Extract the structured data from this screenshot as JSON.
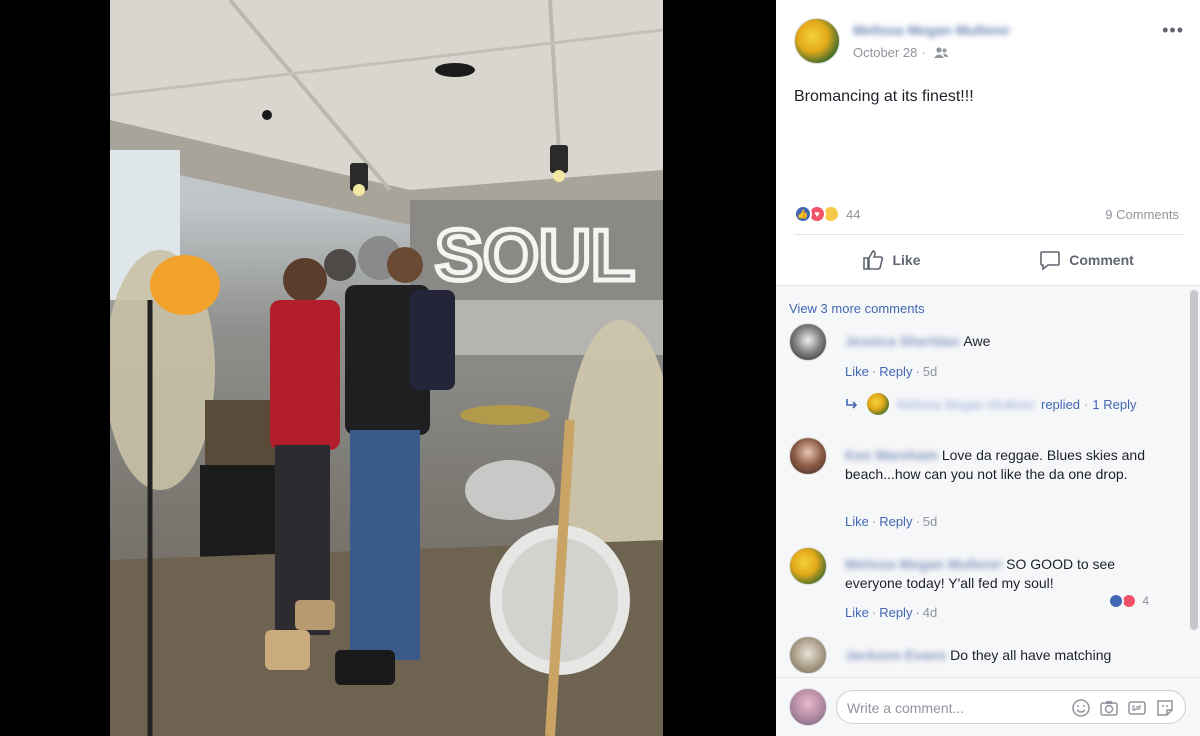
{
  "post": {
    "author": "Melissa Megan Mullerer",
    "date": "October 28",
    "audience_icon": "friends-icon",
    "text": "Bromancing at its finest!!!",
    "reaction_count": "44",
    "comment_count": "9 Comments"
  },
  "actions": {
    "like_label": "Like",
    "comment_label": "Comment"
  },
  "comments_section": {
    "view_more": "View 3 more comments",
    "comments": [
      {
        "author": "Jessica Sheridan",
        "text": "Awe",
        "like": "Like",
        "reply": "Reply",
        "time": "5d",
        "replies_by": "Melissa Megan Mullerer",
        "replied_label": "replied",
        "replies": "1 Reply"
      },
      {
        "author": "Ken Wareham",
        "text": "Love da reggae. Blues skies and beach...how can you not like the da one drop.",
        "like": "Like",
        "reply": "Reply",
        "time": "5d"
      },
      {
        "author": "Melissa Megan Mullerer",
        "text": "SO GOOD to see everyone today! Y'all fed my soul!",
        "like": "Like",
        "reply": "Reply",
        "time": "4d",
        "reaction_count": "4"
      },
      {
        "author": "Jackson Evans",
        "text": "Do they all have matching"
      }
    ]
  },
  "composer": {
    "placeholder": "Write a comment..."
  },
  "photo": {
    "sign_text": "SOUL"
  },
  "colors": {
    "link": "#4267b2",
    "like_blue": "#4267b2",
    "love_red": "#f25268",
    "haha_yellow": "#f7c94b"
  }
}
